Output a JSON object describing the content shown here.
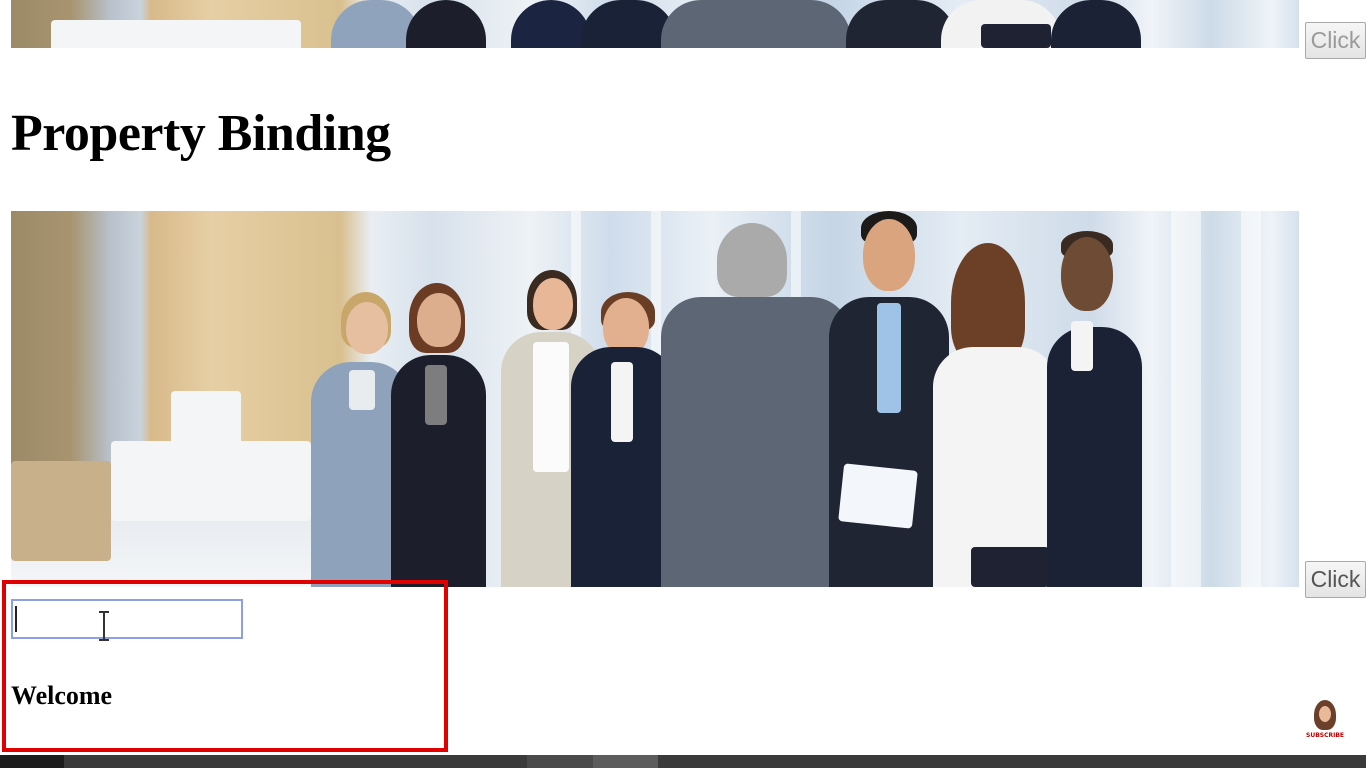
{
  "page": {
    "heading": "Property Binding"
  },
  "images": {
    "banner_top_alt": "business team photo",
    "banner_main_alt": "business team photo"
  },
  "buttons": {
    "top_click_label": "Click",
    "main_click_label": "Click"
  },
  "form": {
    "input_value": "",
    "welcome_text": "Welcome"
  },
  "overlay": {
    "highlight_color": "#e00000",
    "subscribe_label": "SUBSCRIBE"
  }
}
